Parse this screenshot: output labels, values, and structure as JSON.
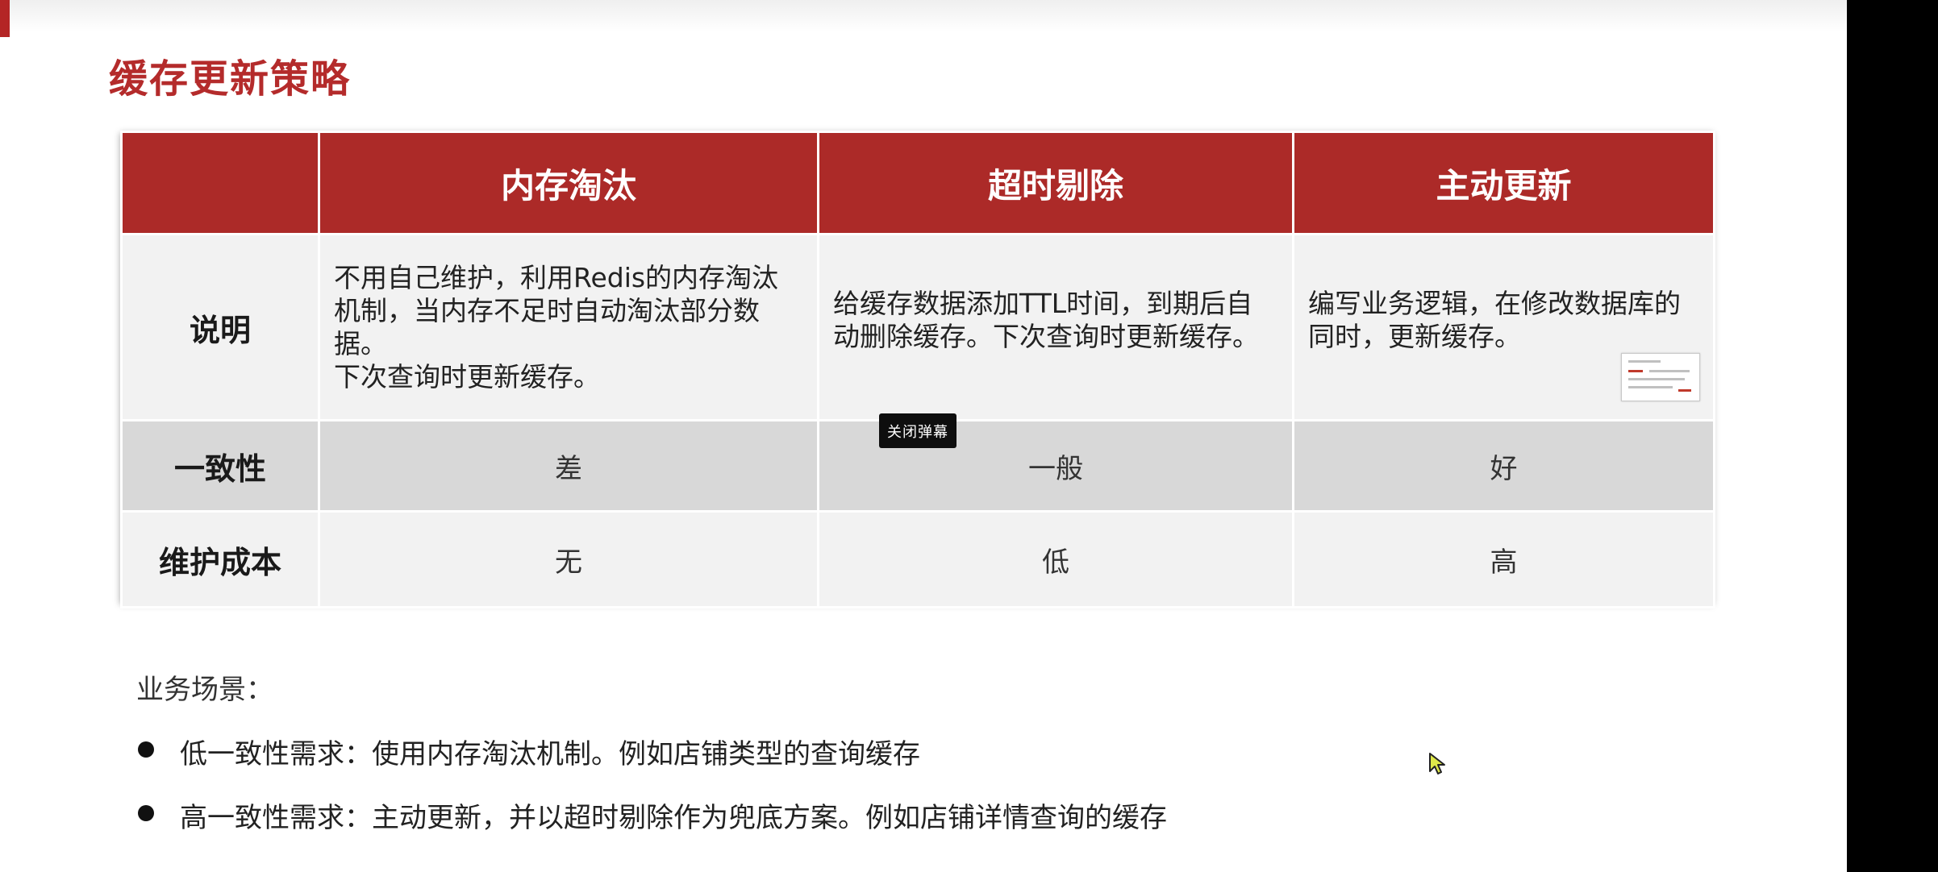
{
  "slide": {
    "title": "缓存更新策略"
  },
  "table": {
    "columns": [
      "",
      "内存淘汰",
      "超时剔除",
      "主动更新"
    ],
    "rows": [
      {
        "label": "说明",
        "cells": [
          [
            "不用自己维护，利用Redis的内存淘汰",
            "机制，当内存不足时自动淘汰部分数据。",
            "下次查询时更新缓存。"
          ],
          [
            "给缓存数据添加TTL时间，到期后自",
            "动删除缓存。下次查询时更新缓存。"
          ],
          [
            "编写业务逻辑，在修改数据库的",
            "同时，更新缓存。"
          ]
        ]
      },
      {
        "label": "一致性",
        "cells": [
          "差",
          "一般",
          "好"
        ]
      },
      {
        "label": "维护成本",
        "cells": [
          "无",
          "低",
          "高"
        ]
      }
    ]
  },
  "overlay": {
    "close_danmaku_label": "关闭弹幕"
  },
  "scenarios": {
    "label": "业务场景：",
    "items": [
      "低一致性需求：使用内存淘汰机制。例如店铺类型的查询缓存",
      "高一致性需求：主动更新，并以超时剔除作为兜底方案。例如店铺详情查询的缓存"
    ]
  },
  "colors": {
    "accent": "#b42b2b",
    "header_bg": "#ac2a28",
    "row_light": "#f2f2f2",
    "row_dark": "#d8d8d8",
    "right_bar": "#000000"
  },
  "icons": {
    "cursor": "mouse-pointer-icon",
    "thumbnail": "slide-thumbnail-icon",
    "bullet": "bullet-dot-icon"
  }
}
